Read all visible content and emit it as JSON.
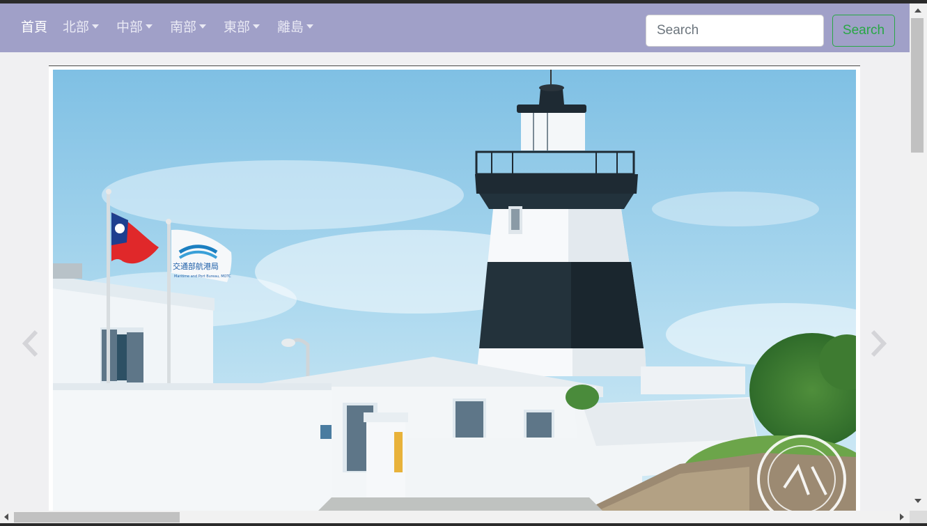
{
  "nav": {
    "items": [
      {
        "label": "首頁",
        "dropdown": false,
        "active": true
      },
      {
        "label": "北部",
        "dropdown": true,
        "active": false
      },
      {
        "label": "中部",
        "dropdown": true,
        "active": false
      },
      {
        "label": "南部",
        "dropdown": true,
        "active": false
      },
      {
        "label": "東部",
        "dropdown": true,
        "active": false
      },
      {
        "label": "離島",
        "dropdown": true,
        "active": false
      }
    ],
    "search": {
      "placeholder": "Search",
      "button_label": "Search"
    }
  },
  "carousel": {
    "slide_image": "lighthouse-photo",
    "flag_text": "交通部航港局",
    "flag_subtext": "Maritime and Port Bureau, MOTC",
    "prev_icon": "chevron-left-icon",
    "next_icon": "chevron-right-icon"
  },
  "colors": {
    "navbar_bg": "#a0a0c8",
    "nav_text": "#e9e9f4",
    "search_button": "#28a745",
    "page_bg": "#f0f0f2"
  }
}
